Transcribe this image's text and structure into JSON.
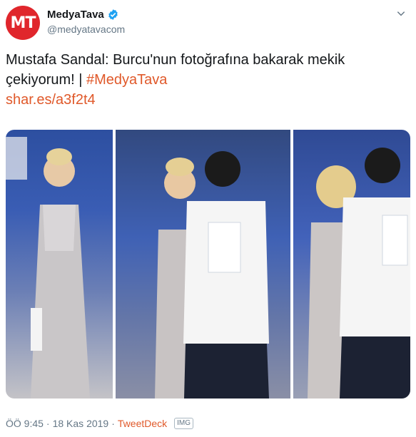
{
  "account": {
    "avatar_text": "MT",
    "display_name": "MedyaTava",
    "handle": "@medyatavacom",
    "verified": true
  },
  "tweet": {
    "text_line": "Mustafa Sandal: Burcu'nun fotoğrafına bakarak mekik çekiyorum! | ",
    "hashtag": "#MedyaTava",
    "short_link": "shar.es/a3f2t4"
  },
  "media": {
    "photo_count": 3
  },
  "meta": {
    "time": "ÖÖ 9:45",
    "separator": " · ",
    "date": "18 Kas 2019",
    "source": "TweetDeck",
    "badge": "IMG"
  },
  "colors": {
    "brand": "#e0262c",
    "link": "#e0592a",
    "verified": "#1da1f2",
    "muted": "#657786"
  },
  "icons": [
    "verified-badge-icon",
    "chevron-down-icon"
  ]
}
